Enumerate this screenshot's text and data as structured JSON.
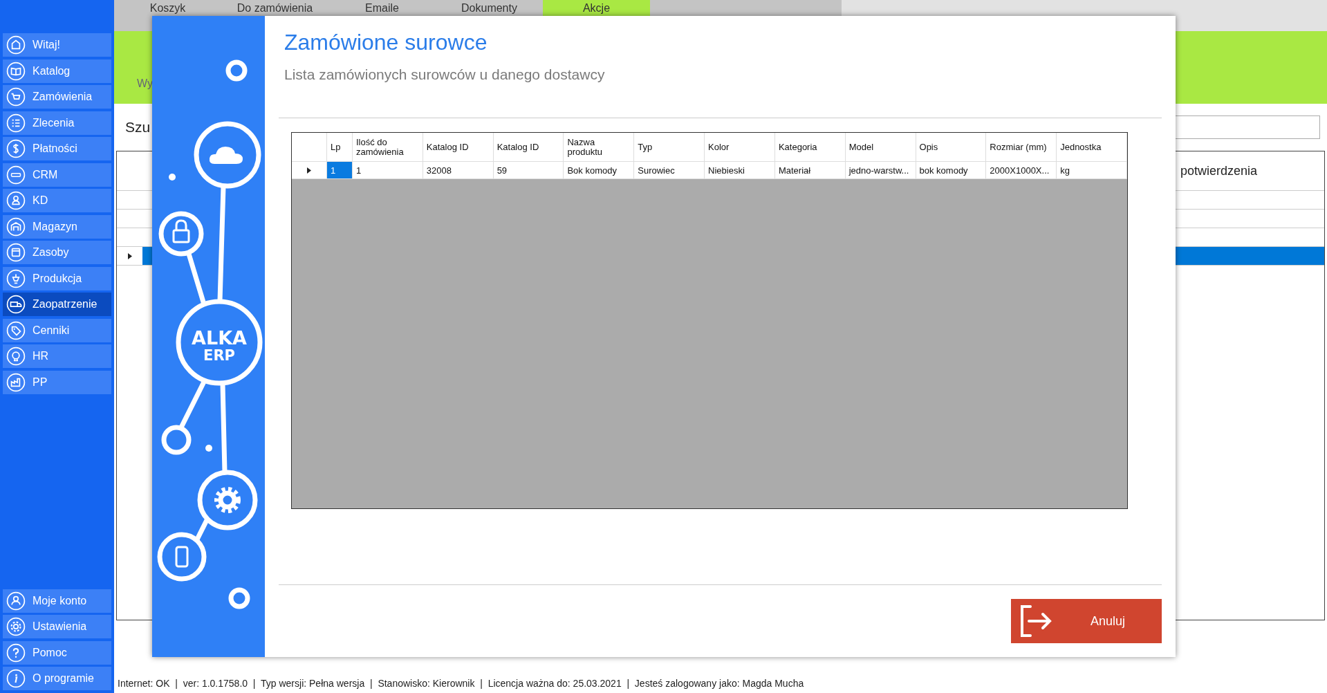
{
  "sidebar": {
    "items": [
      {
        "label": "Witaj!",
        "selected": false
      },
      {
        "label": "Katalog",
        "selected": false
      },
      {
        "label": "Zamówienia",
        "selected": false
      },
      {
        "label": "Zlecenia",
        "selected": false
      },
      {
        "label": "Płatności",
        "selected": false
      },
      {
        "label": "CRM",
        "selected": false
      },
      {
        "label": "KD",
        "selected": false
      },
      {
        "label": "Magazyn",
        "selected": false
      },
      {
        "label": "Zasoby",
        "selected": false
      },
      {
        "label": "Produkcja",
        "selected": false
      },
      {
        "label": "Zaopatrzenie",
        "selected": true
      },
      {
        "label": "Cenniki",
        "selected": false
      },
      {
        "label": "HR",
        "selected": false
      },
      {
        "label": "PP",
        "selected": false
      }
    ],
    "bottom_items": [
      {
        "label": "Moje konto",
        "selected": false
      },
      {
        "label": "Ustawienia",
        "selected": false
      },
      {
        "label": "Pomoc",
        "selected": false
      },
      {
        "label": "O programie",
        "selected": false
      }
    ]
  },
  "tabs": [
    {
      "label": "Koszyk",
      "selected": false
    },
    {
      "label": "Do zamówienia",
      "selected": false
    },
    {
      "label": "Emaile",
      "selected": false
    },
    {
      "label": "Dokumenty",
      "selected": false
    },
    {
      "label": "Akcje",
      "selected": true
    }
  ],
  "banner": {
    "text": "Wy"
  },
  "search": {
    "label": "Szu"
  },
  "background_table": {
    "column": "potwierdzenia",
    "rows": [
      {
        "selected": false
      },
      {
        "selected": false
      },
      {
        "selected": false
      },
      {
        "selected": true
      }
    ]
  },
  "dialog": {
    "title": "Zamówione surowce",
    "subtitle": "Lista zamówionych surowców u danego dostawcy",
    "logo": {
      "line1": "ALKA",
      "line2": "ERP"
    },
    "table": {
      "columns": [
        "Lp",
        "Ilość do zamówienia",
        "Katalog ID",
        "Katalog ID",
        "Nazwa produktu",
        "Typ",
        "Kolor",
        "Kategoria",
        "Model",
        "Opis",
        "Rozmiar (mm)",
        "Jednostka"
      ],
      "rows": [
        {
          "selected": true,
          "cells": [
            "1",
            "1",
            "32008",
            "59",
            "Bok komody",
            "Surowiec",
            "Niebieski",
            "Materiał",
            "jedno-warstw...",
            "bok komody",
            "2000X1000X...",
            "kg"
          ]
        }
      ]
    },
    "cancel_button": "Anuluj"
  },
  "status_bar": "Internet: OK  |  ver: 1.0.1758.0  |  Typ wersji: Pełna wersja  |  Stanowisko: Kierownik  |  Licencja ważna do: 25.03.2021  |  Jesteś zalogowany jako: Magda Mucha"
}
